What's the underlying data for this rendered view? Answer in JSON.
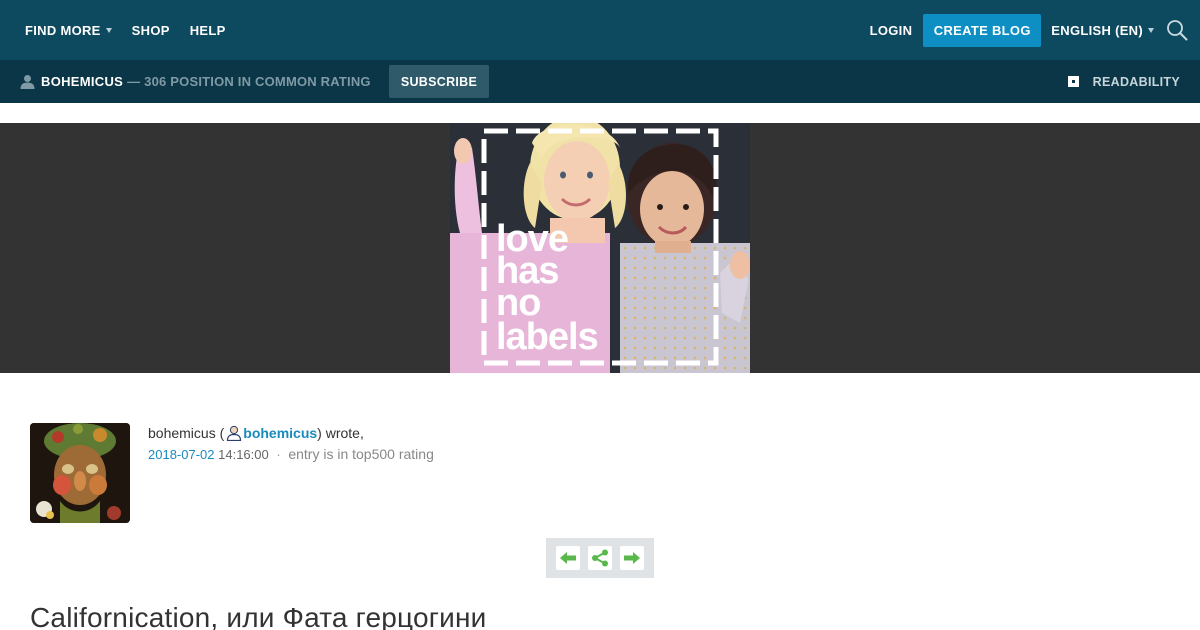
{
  "topnav": {
    "find_more": "FIND MORE",
    "shop": "SHOP",
    "help": "HELP",
    "login": "LOGIN",
    "create_blog": "CREATE BLOG",
    "language": "ENGLISH (EN)",
    "search_icon": "search-icon"
  },
  "journalbar": {
    "username": "BOHEMICUS",
    "rank": "— 306 POSITION IN COMMON RATING",
    "subscribe": "SUBSCRIBE",
    "readability": "READABILITY"
  },
  "banner": {
    "image_text": [
      "love",
      "has",
      "no",
      "labels"
    ]
  },
  "entry": {
    "author_text": "bohemicus (",
    "author_link": "bohemicus",
    "wrote": ") wrote,",
    "date": "2018-07-02",
    "time": "14:16:00",
    "dot": "·",
    "rating_note": "entry is in top500 rating",
    "title": "Californication, или Фата герцогини"
  },
  "controls": {
    "prev_icon": "arrow-left-icon",
    "share_icon": "share-icon",
    "next_icon": "arrow-right-icon"
  },
  "colors": {
    "topbar": "#0e4a5f",
    "journalbar": "#0b3647",
    "accent": "#0d8fc4",
    "link": "#1b8bbd",
    "banner_bg": "#333333",
    "icon_green": "#58b84c"
  }
}
